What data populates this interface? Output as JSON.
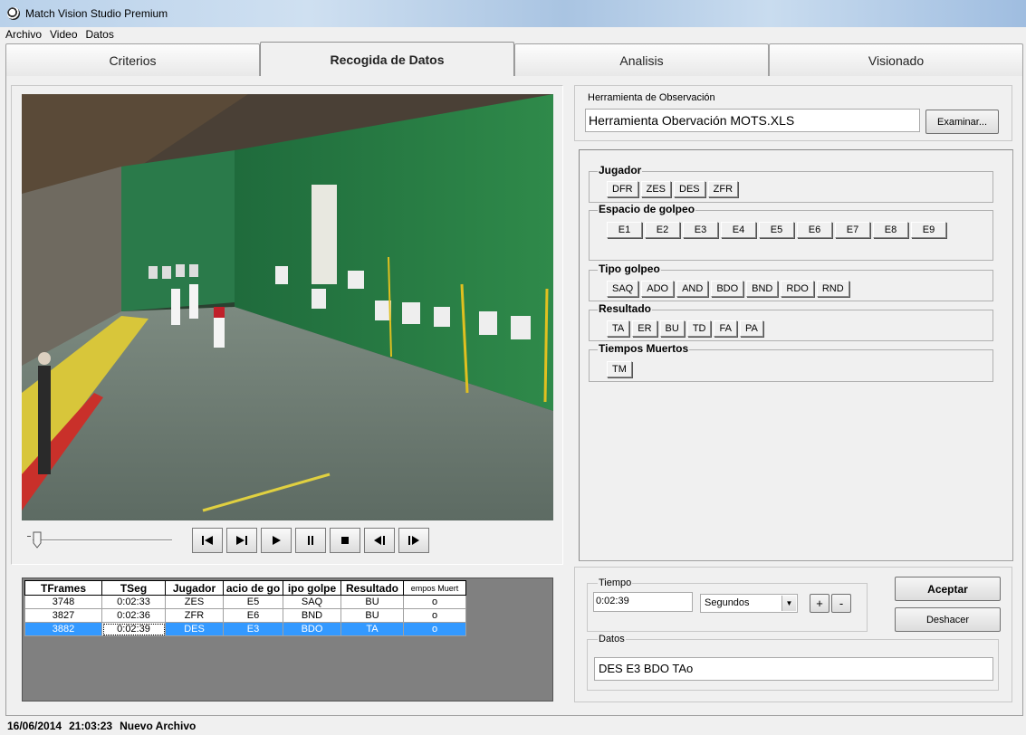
{
  "window": {
    "title": "Match Vision Studio Premium"
  },
  "menu": [
    "Archivo",
    "Video",
    "Datos"
  ],
  "tabs": [
    {
      "label": "Criterios",
      "active": false
    },
    {
      "label": "Recogida de Datos",
      "active": true
    },
    {
      "label": "Analisis",
      "active": false
    },
    {
      "label": "Visionado",
      "active": false
    }
  ],
  "transport": [
    "skip-to-start-icon",
    "step-forward-icon",
    "play-icon",
    "pause-icon",
    "stop-icon",
    "frame-back-icon",
    "frame-forward-icon"
  ],
  "table": {
    "headers": [
      "TFrames",
      "TSeg",
      "Jugador",
      "acio de go",
      "ipo golpe",
      "Resultado",
      "empos Muert"
    ],
    "rows": [
      [
        "3748",
        "0:02:33",
        "ZES",
        "E5",
        "SAQ",
        "BU",
        "o"
      ],
      [
        "3827",
        "0:02:36",
        "ZFR",
        "E6",
        "BND",
        "BU",
        "o"
      ],
      [
        "3882",
        "0:02:39",
        "DES",
        "E3",
        "BDO",
        "TA",
        "o"
      ]
    ],
    "selected_row": 2
  },
  "tool": {
    "legend": "Herramienta de Observación",
    "value": "Herramienta Obervación MOTS.XLS",
    "browse_label": "Examinar..."
  },
  "criteria": [
    {
      "name": "Jugador",
      "values": [
        "DFR",
        "ZES",
        "DES",
        "ZFR"
      ]
    },
    {
      "name": "Espacio de golpeo",
      "values": [
        "E1",
        "E2",
        "E3",
        "E4",
        "E5",
        "E6",
        "E7",
        "E8",
        "E9"
      ]
    },
    {
      "name": "Tipo golpeo",
      "values": [
        "SAQ",
        "ADO",
        "AND",
        "BDO",
        "BND",
        "RDO",
        "RND"
      ]
    },
    {
      "name": "Resultado",
      "values": [
        "TA",
        "ER",
        "BU",
        "TD",
        "FA",
        "PA"
      ]
    },
    {
      "name": "Tiempos Muertos",
      "values": [
        "TM"
      ]
    }
  ],
  "tiempo": {
    "legend": "Tiempo",
    "value": "0:02:39",
    "unit": "Segundos",
    "plus": "+",
    "minus": "-"
  },
  "actions": {
    "accept": "Aceptar",
    "undo": "Deshacer"
  },
  "datos": {
    "legend": "Datos",
    "value": "DES E3 BDO TAo"
  },
  "status": {
    "date": "16/06/2014",
    "time": "21:03:23",
    "file": "Nuevo Archivo"
  }
}
